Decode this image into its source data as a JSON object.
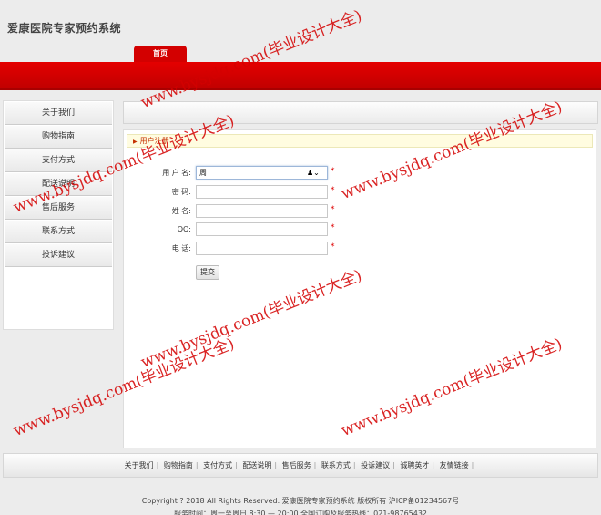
{
  "site": {
    "title": "爱康医院专家预约系统"
  },
  "nav": {
    "tabs": [
      "首页"
    ]
  },
  "sidebar": {
    "items": [
      "关于我们",
      "购物指南",
      "支付方式",
      "配送说明",
      "售后服务",
      "联系方式",
      "投诉建议"
    ]
  },
  "main": {
    "breadcrumb": "用户注册",
    "form": {
      "username": {
        "label": "用 户 名:",
        "value": "周"
      },
      "password": {
        "label": "密 码:",
        "value": ""
      },
      "name": {
        "label": "姓 名:",
        "value": ""
      },
      "qq": {
        "label": "QQ:",
        "value": ""
      },
      "phone": {
        "label": "电 话:",
        "value": ""
      },
      "required_mark": "*",
      "submit_label": "提交"
    }
  },
  "footer": {
    "links": [
      "关于我们",
      "购物指南",
      "支付方式",
      "配送说明",
      "售后服务",
      "联系方式",
      "投诉建议",
      "诚聘英才",
      "友情链接"
    ],
    "copyright": "Copyright ? 2018 All Rights Reserved. 爱康医院专家预约系统 版权所有  沪ICP备01234567号",
    "hotline": "服务时间：周一至周日 8:30 — 20:00  全国订购及服务热线：021-98765432"
  },
  "watermark": {
    "text": "www.bysjdq.com(毕业设计大全)"
  },
  "colors": {
    "nav_red": "#d30000",
    "accent_red": "#c53000",
    "watermark": "#d40000"
  }
}
